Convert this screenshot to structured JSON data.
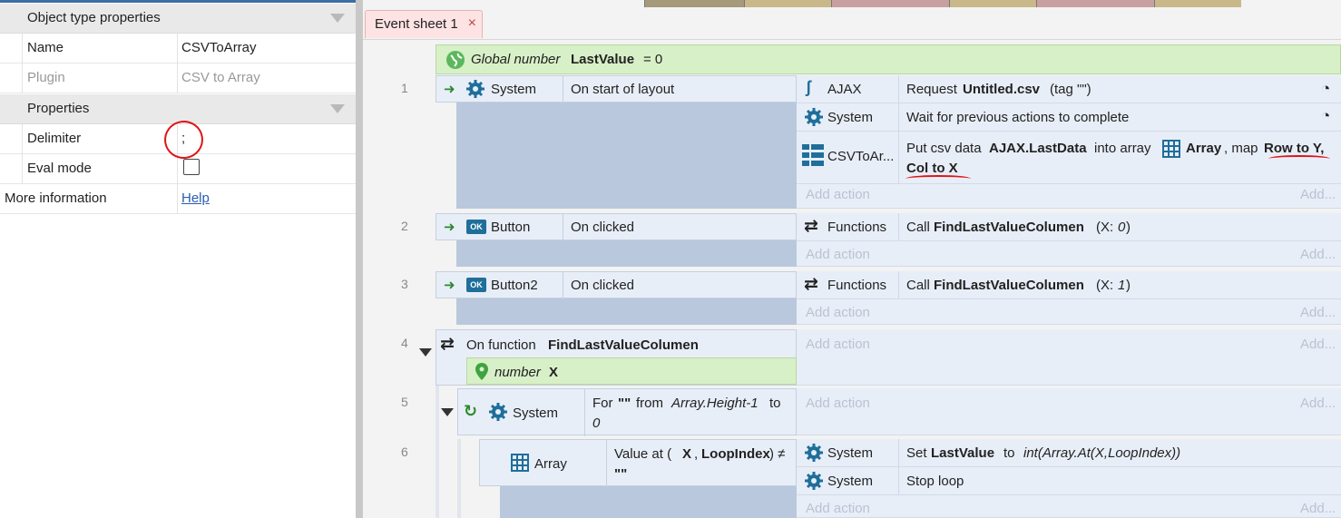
{
  "properties": {
    "section1": "Object type properties",
    "name_label": "Name",
    "name_value": "CSVToArray",
    "plugin_label": "Plugin",
    "plugin_value": "CSV to Array",
    "section2": "Properties",
    "delimiter_label": "Delimiter",
    "delimiter_value": ";",
    "eval_label": "Eval mode",
    "more_label": "More information",
    "help_link": "Help"
  },
  "tab": {
    "label": "Event sheet 1",
    "close": "×"
  },
  "global": {
    "prefix": "Global number",
    "name": "LastValue",
    "rest": "= 0"
  },
  "events": {
    "e1": {
      "num": "1",
      "obj": "System",
      "cond": "On start of layout",
      "a1_obj": "AJAX",
      "a1_pre": "Request",
      "a1_bold": "Untitled.csv",
      "a1_post": "(tag \"\")",
      "a2_obj": "System",
      "a2_text": "Wait for previous actions to complete",
      "a3_obj": "CSVToAr...",
      "a3_pre": "Put csv data",
      "a3_b1": "AJAX.LastData",
      "a3_mid": "into array",
      "a3_b2": "Array",
      "a3_mid2": ", map",
      "a3_b3": "Row to Y,",
      "a3_b4": "Col to X"
    },
    "e2": {
      "num": "2",
      "obj": "Button",
      "cond": "On clicked",
      "a1_obj": "Functions",
      "a1_pre": "Call",
      "a1_bold": "FindLastValueColumen",
      "a1_post": "(X:",
      "a1_arg": "0",
      "a1_end": ")"
    },
    "e3": {
      "num": "3",
      "obj": "Button2",
      "cond": "On clicked",
      "a1_obj": "Functions",
      "a1_pre": "Call",
      "a1_bold": "FindLastValueColumen",
      "a1_post": "(X:",
      "a1_arg": "1",
      "a1_end": ")"
    },
    "e4": {
      "num": "4",
      "pre": "On function",
      "bold": "FindLastValueColumen",
      "param_type": "number",
      "param_name": "X"
    },
    "e5": {
      "num": "5",
      "obj": "System",
      "c_pre": "For",
      "c_b": "\"\"",
      "c_mid": "from",
      "c_it": "Array.Height-1",
      "c_to": "to",
      "c_zero": "0"
    },
    "e6": {
      "num": "6",
      "obj": "Array",
      "c_pre": "Value at (",
      "c_b1": "X",
      "c_comma": ",",
      "c_b2": "LoopIndex",
      "c_post": ") ≠",
      "c_b3": "\"\"",
      "a1_obj": "System",
      "a1_pre": "Set",
      "a1_bold": "LastValue",
      "a1_to": "to",
      "a1_it": "int(Array.At(X,LoopIndex))",
      "a2_obj": "System",
      "a2_text": "Stop loop"
    }
  },
  "add_action": "Add action",
  "add_more": "Add..."
}
